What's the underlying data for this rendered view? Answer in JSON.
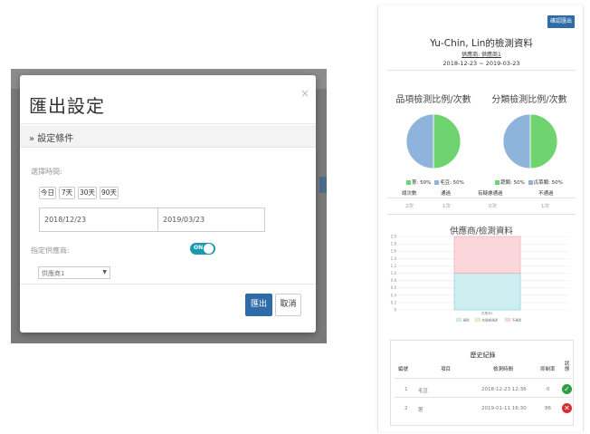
{
  "export_dialog": {
    "title": "匯出設定",
    "close_icon": "×",
    "section_label": "» 設定條件",
    "time_label": "選擇時間:",
    "quick_ranges": [
      "今日",
      "7天",
      "30天",
      "90天"
    ],
    "date_from": "2018/12/23",
    "date_separator": "~",
    "date_to": "2019/03/23",
    "supplier_label": "指定供應商:",
    "toggle_text": "ON",
    "toggle_on": true,
    "supplier_select": "供應商1",
    "export_button": "匯出",
    "cancel_button": "取消",
    "primary_color": "#2d6ca8",
    "toggle_color": "#1a9ab0"
  },
  "report": {
    "print_button": "確認匯出",
    "title": "Yu-Chin, Lin的檢測資料",
    "subtitle": "供應商: 供應商1",
    "date_range": "2018-12-23 ~ 2019-03-23",
    "pie_left": {
      "title": "品項檢測比例/次數",
      "legend": [
        "蔥: 50%",
        "毛豆: 50%"
      ],
      "stats_headers": [
        "總次數",
        "通過"
      ],
      "stats_values": [
        "2次",
        "1次"
      ]
    },
    "pie_right": {
      "title": "分類檢測比例/次數",
      "legend": [
        "蔬類: 50%",
        "瓜菜類: 50%"
      ],
      "stats_headers": [
        "有疑慮通過",
        "不通過"
      ],
      "stats_values": [
        "0次",
        "1次"
      ]
    },
    "bar_chart_title": "供應商/檢測資料",
    "history": {
      "title": "歷史紀錄",
      "headers": [
        "編號",
        "項目",
        "檢測時間",
        "抑制率",
        "狀態"
      ],
      "rows": [
        {
          "no": "1",
          "item": "毛豆",
          "time": "2018-12-23 12:36",
          "rate": "0",
          "status": "pass"
        },
        {
          "no": "2",
          "item": "蔥",
          "time": "2019-01-11 16:30",
          "rate": "86",
          "status": "fail"
        }
      ]
    },
    "colors": {
      "green": "#6fd46f",
      "blue": "#8fb4dc",
      "pass": "#2e9e3e",
      "fail": "#d92b2b"
    }
  },
  "chart_data": [
    {
      "type": "pie",
      "title": "品項檢測比例/次數",
      "labels": [
        "蔥",
        "毛豆"
      ],
      "values": [
        50,
        50
      ],
      "colors": [
        "#6fd46f",
        "#8fb4dc"
      ]
    },
    {
      "type": "pie",
      "title": "分類檢測比例/次數",
      "labels": [
        "蔬類",
        "瓜菜類"
      ],
      "values": [
        50,
        50
      ],
      "colors": [
        "#6fd46f",
        "#8fb4dc"
      ]
    },
    {
      "type": "bar",
      "title": "供應商/檢測資料",
      "categories": [
        "供應商1"
      ],
      "series": [
        {
          "name": "通過",
          "values": [
            1
          ],
          "color": "#cdeef1"
        },
        {
          "name": "有疑慮通過",
          "values": [
            0
          ],
          "color": "#fbe7c4"
        },
        {
          "name": "不通過",
          "values": [
            1
          ],
          "color": "#fbd7dc"
        }
      ],
      "stacked": true,
      "ylim": [
        0,
        2
      ],
      "yticks": [
        "0",
        "0.2",
        "0.4",
        "0.6",
        "0.8",
        "1.0",
        "1.2",
        "1.4",
        "1.6",
        "1.8",
        "2.0"
      ],
      "grid": true,
      "legend_position": "bottom"
    }
  ]
}
